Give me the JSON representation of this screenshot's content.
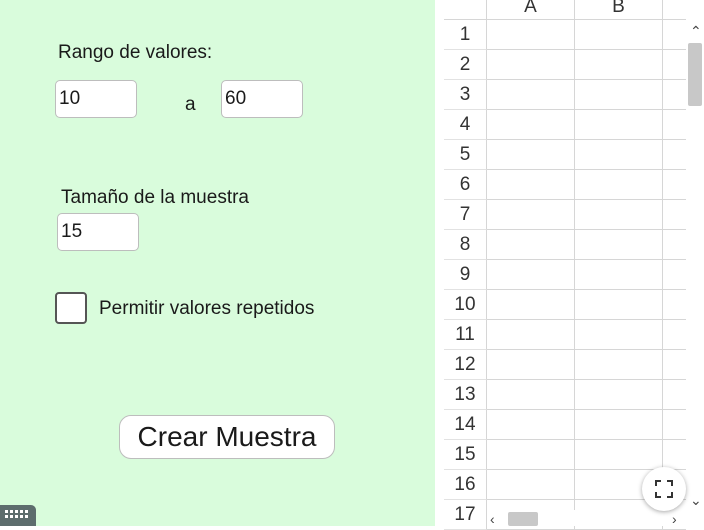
{
  "form": {
    "range_label": "Rango de valores:",
    "range_min": "10",
    "range_sep": "a",
    "range_max": "60",
    "sample_size_label": "Tamaño de la muestra",
    "sample_size": "15",
    "allow_repeats_label": "Permitir valores repetidos",
    "allow_repeats_checked": false,
    "create_button": "Crear Muestra"
  },
  "spreadsheet": {
    "columns": [
      "A",
      "B"
    ],
    "rows": [
      "1",
      "2",
      "3",
      "4",
      "5",
      "6",
      "7",
      "8",
      "9",
      "10",
      "11",
      "12",
      "13",
      "14",
      "15",
      "16",
      "17"
    ]
  },
  "icons": {
    "keyboard": "keyboard-icon",
    "fullscreen": "fullscreen-icon"
  },
  "colors": {
    "panel_background": "#d9fcdc"
  }
}
